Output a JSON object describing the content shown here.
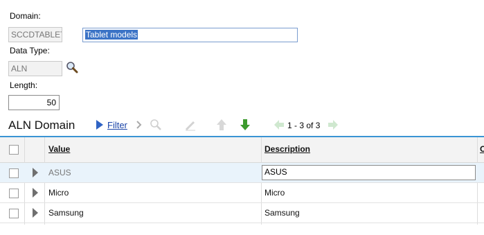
{
  "form": {
    "domain_label": "Domain:",
    "domain_value": "SCCDTABLET",
    "description_value": "Tablet models",
    "datatype_label": "Data Type:",
    "datatype_value": "ALN",
    "length_label": "Length:",
    "length_value": "50"
  },
  "toolbar": {
    "title": "ALN Domain",
    "filter_label": "Filter",
    "pager_text": "1 - 3 of 3"
  },
  "table": {
    "headers": {
      "value": "Value",
      "description": "Description",
      "extra": "O"
    },
    "rows": [
      {
        "value": "ASUS",
        "description": "ASUS",
        "selected": true
      },
      {
        "value": "Micro",
        "description": "Micro",
        "selected": false
      },
      {
        "value": "Samsung",
        "description": "Samsung",
        "selected": false
      }
    ]
  },
  "colors": {
    "accent": "#3a94d4",
    "link": "#1a44a8",
    "selection": "#3b73c6"
  }
}
